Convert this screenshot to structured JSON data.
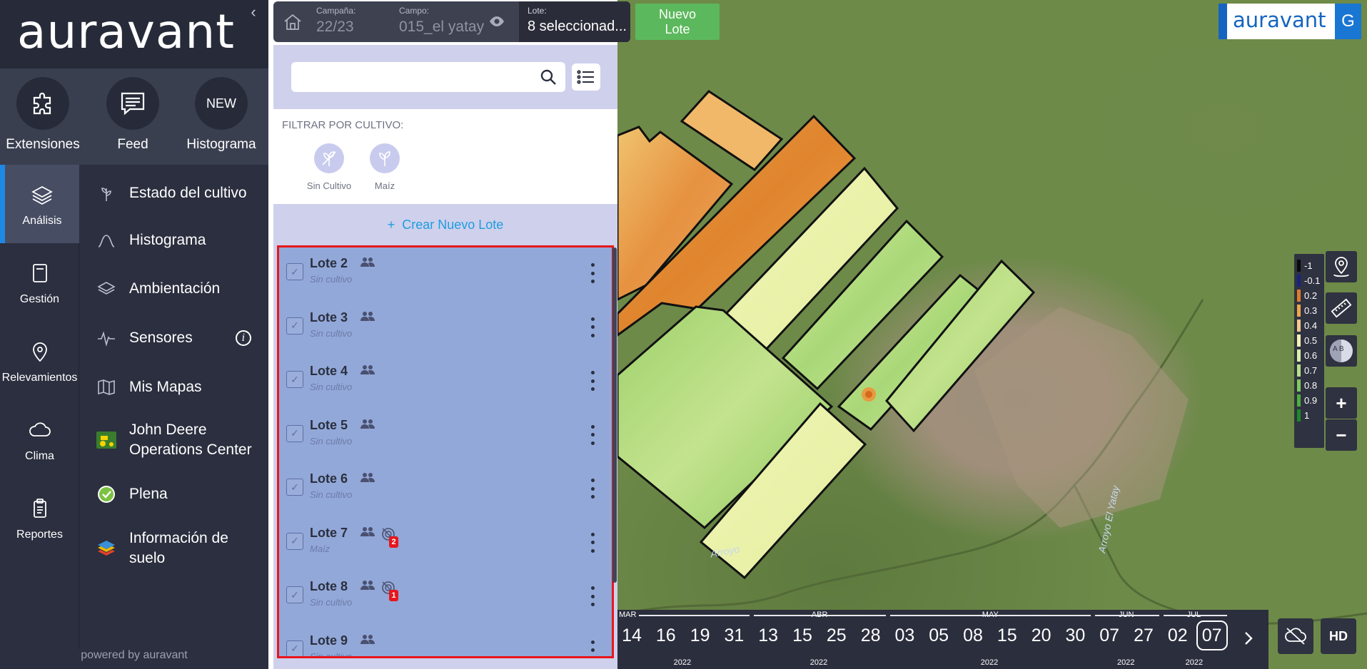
{
  "brand": {
    "logo": "auravant",
    "collapse_glyph": "‹",
    "top_logo": "auravant",
    "top_letter": "G"
  },
  "quick": [
    {
      "label": "Extensiones",
      "icon": "puzzle-icon"
    },
    {
      "label": "Feed",
      "icon": "feed-icon"
    },
    {
      "label": "Histograma",
      "icon": "new-badge",
      "badge": "NEW"
    }
  ],
  "rail": [
    {
      "label": "Análisis",
      "icon": "layers-icon",
      "active": true
    },
    {
      "label": "Gestión",
      "icon": "notebook-icon"
    },
    {
      "label": "Relevamientos",
      "icon": "location-pin-icon"
    },
    {
      "label": "Clima",
      "icon": "cloud-icon"
    },
    {
      "label": "Reportes",
      "icon": "clipboard-icon"
    }
  ],
  "menu": [
    {
      "label": "Estado del cultivo",
      "icon": "plant-icon"
    },
    {
      "label": "Histograma",
      "icon": "bell-curve-icon"
    },
    {
      "label": "Ambientación",
      "icon": "layers-icon"
    },
    {
      "label": "Sensores",
      "icon": "pulse-icon",
      "info": "i"
    },
    {
      "label": "Mis Mapas",
      "icon": "map-icon"
    },
    {
      "label": "John Deere\nOperations Center",
      "icon": "tractor-icon"
    },
    {
      "label": "Plena",
      "icon": "check-leaf-icon"
    },
    {
      "label": "Información de\nsuelo",
      "icon": "soil-layers-icon"
    }
  ],
  "powered_by": "powered by auravant",
  "topbar": {
    "campana_label": "Campaña:",
    "campana_value": "22/23",
    "campo_label": "Campo:",
    "campo_value": "015_el yatay",
    "lote_label": "Lote:",
    "lote_value": "8 seleccionad...",
    "nuevo_lote": "Nuevo\nLote"
  },
  "search": {
    "placeholder": "",
    "value": ""
  },
  "filter": {
    "title": "FILTRAR POR CULTIVO:",
    "crops": [
      {
        "label": "Sin Cultivo"
      },
      {
        "label": "Maíz"
      }
    ]
  },
  "create_label": "Crear Nuevo Lote",
  "create_plus": "+",
  "lotes": [
    {
      "name": "Lote 2",
      "crop": "Sin cultivo",
      "badge": null
    },
    {
      "name": "Lote 3",
      "crop": "Sin cultivo",
      "badge": null
    },
    {
      "name": "Lote 4",
      "crop": "Sin cultivo",
      "badge": null
    },
    {
      "name": "Lote 5",
      "crop": "Sin cultivo",
      "badge": null
    },
    {
      "name": "Lote 6",
      "crop": "Sin cultivo",
      "badge": null
    },
    {
      "name": "Lote 7",
      "crop": "Maíz",
      "badge": "2"
    },
    {
      "name": "Lote 8",
      "crop": "Sin cultivo",
      "badge": "1"
    },
    {
      "name": "Lote 9",
      "crop": "Sin cultivo",
      "badge": null
    }
  ],
  "legend": [
    {
      "value": "-1",
      "color": "#0a0a0a"
    },
    {
      "value": "-0.1",
      "color": "#1a237e"
    },
    {
      "value": "0.2",
      "color": "#e07b2a"
    },
    {
      "value": "0.3",
      "color": "#f0a64a"
    },
    {
      "value": "0.4",
      "color": "#f6c887"
    },
    {
      "value": "0.5",
      "color": "#f7f1b5"
    },
    {
      "value": "0.6",
      "color": "#dcefa8"
    },
    {
      "value": "0.7",
      "color": "#b6e08a"
    },
    {
      "value": "0.8",
      "color": "#7fca5c"
    },
    {
      "value": "0.9",
      "color": "#4caf3a"
    },
    {
      "value": "1",
      "color": "#1b8a2a"
    }
  ],
  "map_labels": [
    "Arroyo",
    "Arroyo El Yatay"
  ],
  "zoom": {
    "in": "+",
    "out": "−"
  },
  "compare_ab": "A B",
  "timeline": {
    "months": [
      {
        "label": "MAR",
        "year": "2022"
      },
      {
        "label": "ABR",
        "year": "2022"
      },
      {
        "label": "MAY",
        "year": "2022"
      },
      {
        "label": "JUN",
        "year": "2022"
      },
      {
        "label": "JUL",
        "year": "2022"
      }
    ],
    "days": [
      "14",
      "16",
      "19",
      "31",
      "13",
      "15",
      "25",
      "28",
      "03",
      "05",
      "08",
      "15",
      "20",
      "30",
      "07",
      "27",
      "02",
      "07"
    ],
    "selected_index": 17,
    "next": "›"
  },
  "hd_label": "HD"
}
